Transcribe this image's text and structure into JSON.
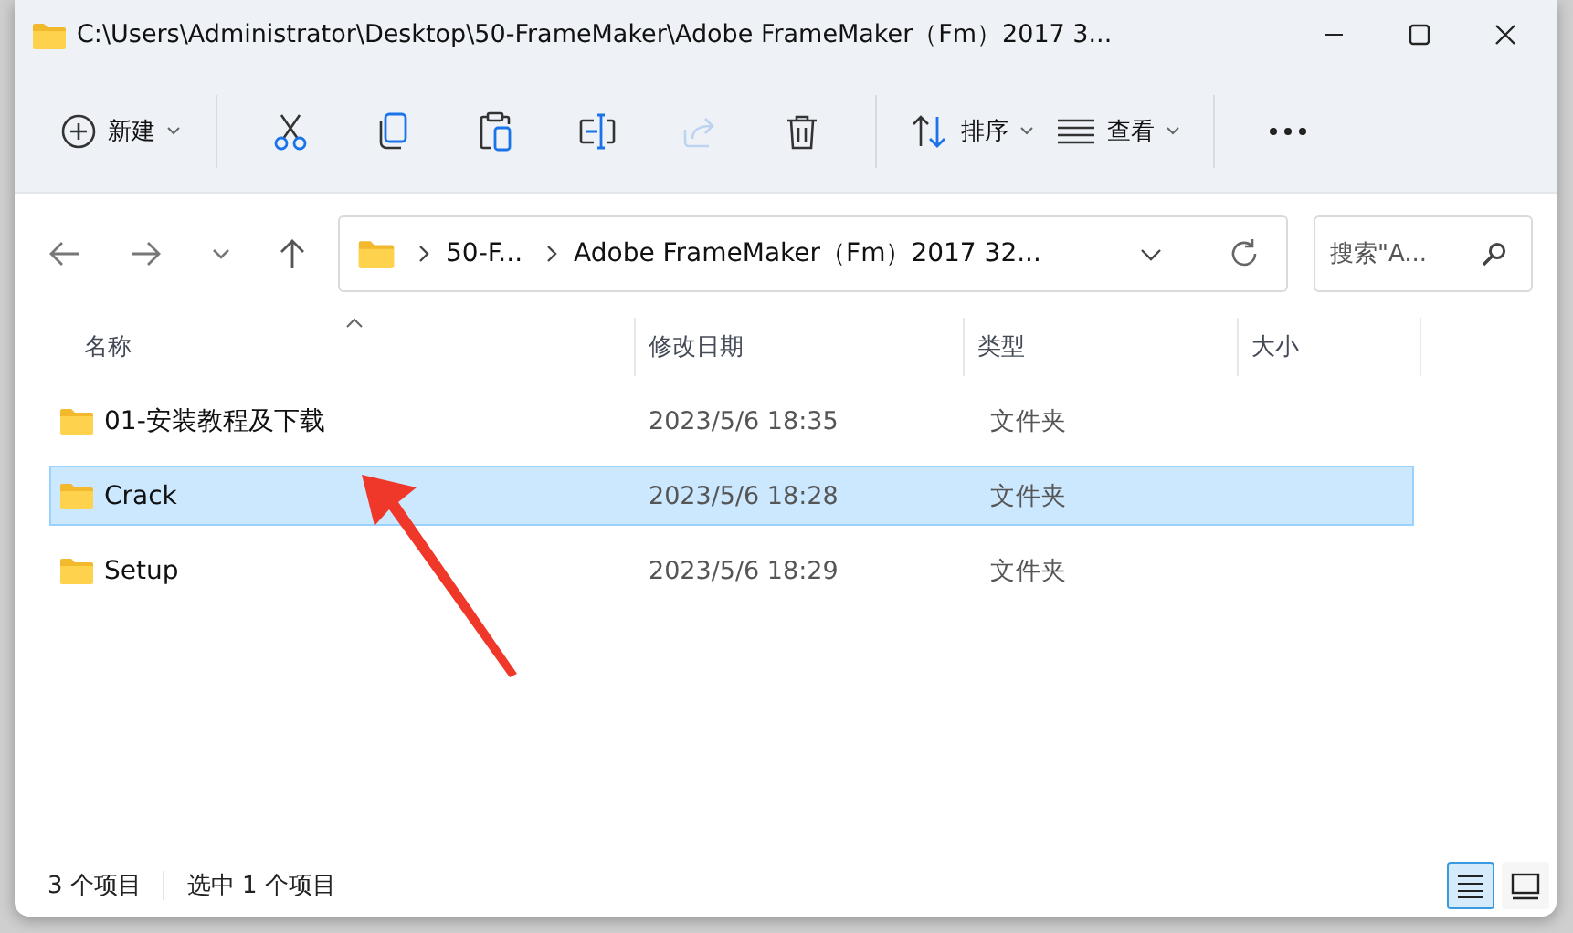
{
  "window": {
    "title": "C:\\Users\\Administrator\\Desktop\\50-FrameMaker\\Adobe FrameMaker（Fm）2017 3..."
  },
  "toolbar": [
    {
      "kind": "new",
      "label": "新建",
      "disabled": false
    },
    {
      "kind": "cut",
      "disabled": false
    },
    {
      "kind": "copy",
      "disabled": false
    },
    {
      "kind": "paste",
      "disabled": false
    },
    {
      "kind": "rename",
      "disabled": false
    },
    {
      "kind": "share",
      "disabled": true
    },
    {
      "kind": "delete",
      "disabled": false
    },
    {
      "kind": "sort",
      "label": "排序",
      "disabled": false
    },
    {
      "kind": "view",
      "label": "查看",
      "disabled": false
    },
    {
      "kind": "more",
      "disabled": false
    }
  ],
  "address": {
    "crumbs": [
      "50-F...",
      "Adobe FrameMaker（Fm）2017 32..."
    ]
  },
  "search": {
    "placeholder": "搜索\"A..."
  },
  "table": {
    "columns": [
      "名称",
      "修改日期",
      "类型",
      "大小"
    ],
    "rows": [
      {
        "name": "01-安装教程及下载",
        "modified": "2023/5/6 18:35",
        "type": "文件夹",
        "selected": false
      },
      {
        "name": "Crack",
        "modified": "2023/5/6 18:28",
        "type": "文件夹",
        "selected": true
      },
      {
        "name": "Setup",
        "modified": "2023/5/6 18:29",
        "type": "文件夹",
        "selected": false
      }
    ]
  },
  "status_bar": {
    "count": "3 个项目",
    "selection": "选中 1 个项目"
  },
  "view_buttons": [
    {
      "kind": "details",
      "selected": true
    },
    {
      "kind": "tiles",
      "selected": false
    }
  ]
}
